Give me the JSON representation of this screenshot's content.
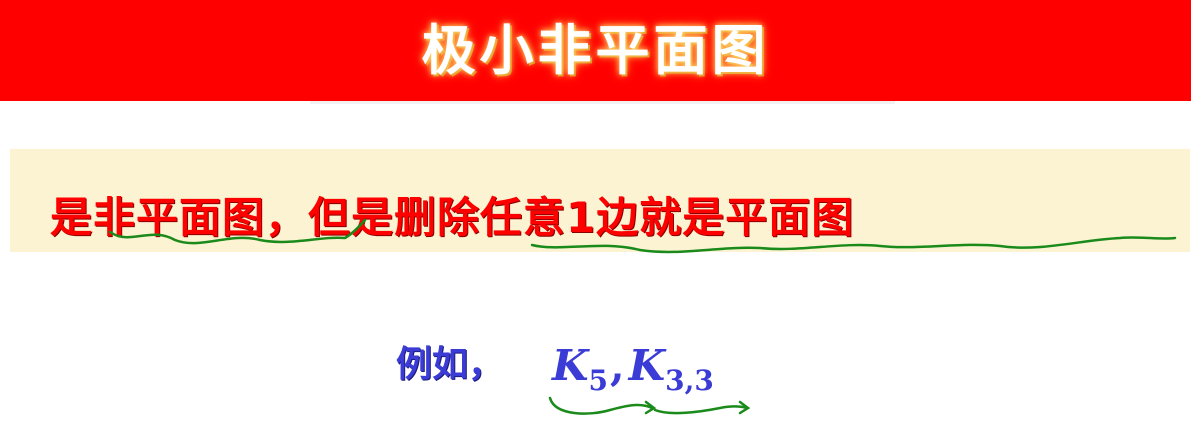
{
  "title": "极小非平面图",
  "definition": "是非平面图，但是删除任意1边就是平面图",
  "example": {
    "label": "例如，",
    "graph1_letter": "K",
    "graph1_sub": "5",
    "separator": ",",
    "graph2_letter": "K",
    "graph2_sub": "3,3"
  },
  "colors": {
    "title_bar": "#ff0000",
    "title_text": "#ffffff",
    "definition_box": "#fcf3d3",
    "definition_text": "#ff0000",
    "example_text": "#3b3bd6",
    "annotation_ink": "#1a8a1a"
  }
}
